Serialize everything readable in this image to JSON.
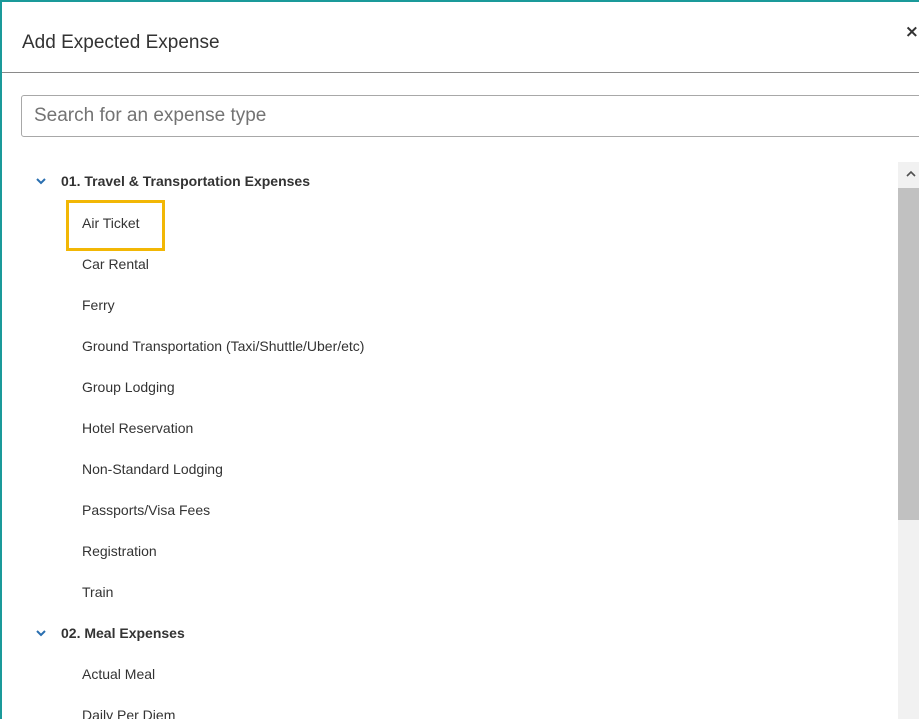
{
  "dialog": {
    "title": "Add Expected Expense",
    "close_label": "×"
  },
  "search": {
    "placeholder": "Search for an expense type",
    "value": ""
  },
  "categories": [
    {
      "label": "01. Travel & Transportation Expenses",
      "expanded": true,
      "items": [
        "Air Ticket",
        "Car Rental",
        "Ferry",
        "Ground Transportation (Taxi/Shuttle/Uber/etc)",
        "Group Lodging",
        "Hotel Reservation",
        "Non-Standard Lodging",
        "Passports/Visa Fees",
        "Registration",
        "Train"
      ]
    },
    {
      "label": "02. Meal Expenses",
      "expanded": true,
      "items": [
        "Actual Meal",
        "Daily Per Diem"
      ]
    }
  ],
  "highlighted_item": "Air Ticket",
  "colors": {
    "accent_border": "#1a9a9a",
    "highlight": "#f2b705",
    "chevron": "#2a6fb0"
  },
  "icons": {
    "chevron": "chevron-down-icon",
    "scroll_up": "chevron-up-icon",
    "close": "close-icon"
  }
}
